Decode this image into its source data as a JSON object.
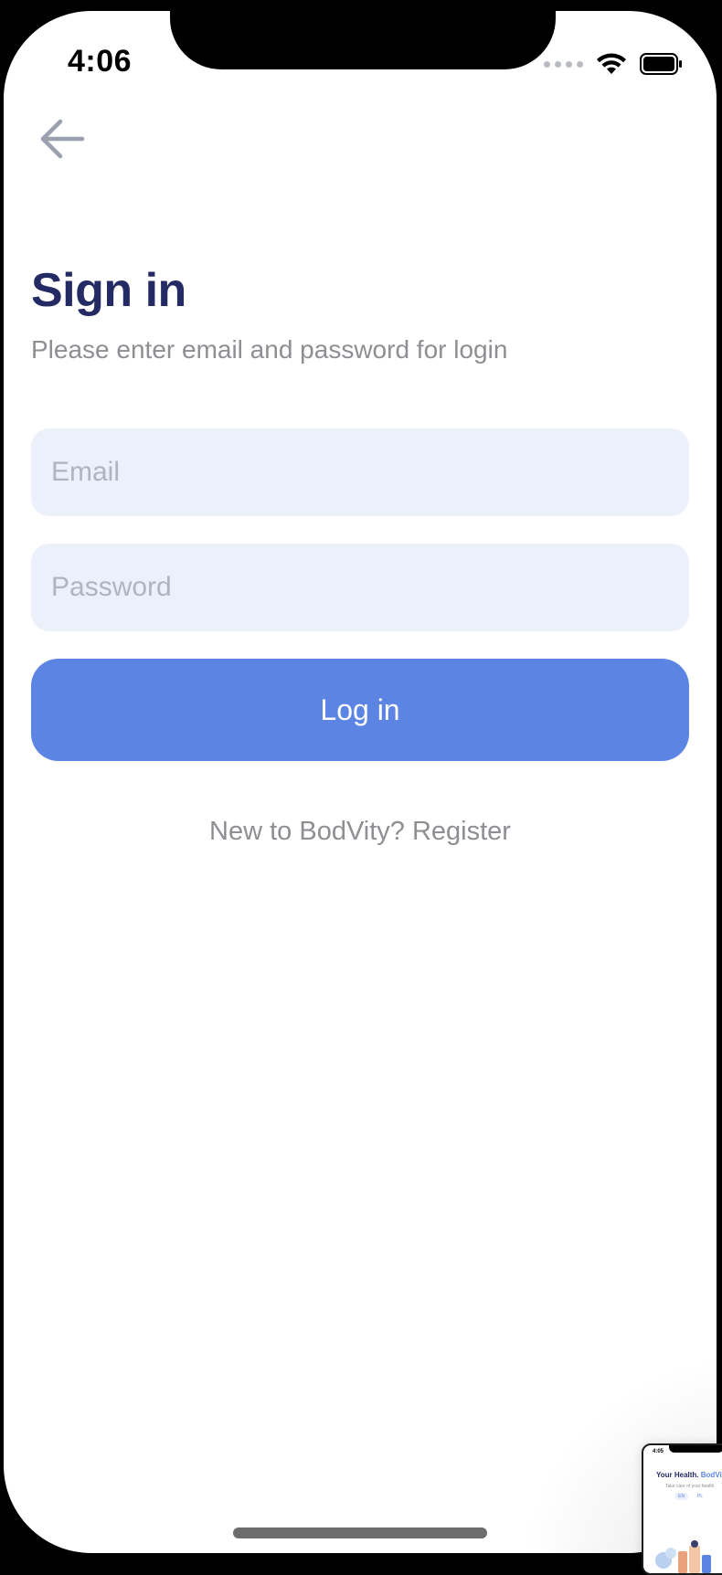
{
  "status_bar": {
    "time": "4:06"
  },
  "nav": {
    "back_icon": "arrow-left-icon"
  },
  "header": {
    "title": "Sign in",
    "subtitle": "Please enter email and password for login"
  },
  "form": {
    "email_placeholder": "Email",
    "email_value": "",
    "password_placeholder": "Password",
    "password_value": "",
    "login_label": "Log in"
  },
  "footer": {
    "register_text": "New to BodVity? Register"
  },
  "thumbnail": {
    "time": "4:05",
    "title_prefix": "Your Health.",
    "title_brand": "BodVit",
    "subtitle": "Take care of your health",
    "chips": [
      "EN",
      "PL"
    ]
  },
  "colors": {
    "title": "#242a63",
    "accent": "#5b84e3",
    "input_bg": "#ecf0fa",
    "muted_text": "#8e8e93"
  }
}
